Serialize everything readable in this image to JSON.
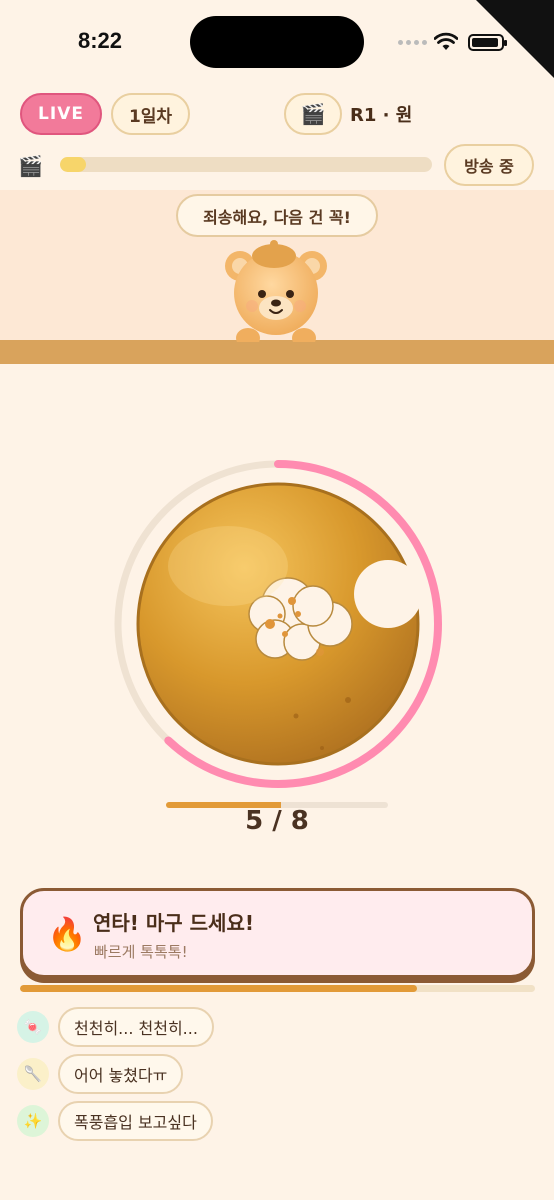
{
  "status_bar": {
    "time": "8:22"
  },
  "header": {
    "live_label": "LIVE",
    "day_label": "1일차",
    "round_icon": "clapperboard-icon",
    "round_label": "R1 · 원",
    "broadcast_progress": 0.07,
    "onair_label": "방송 중"
  },
  "stage": {
    "speech": "죄송해요, 다음 건 꼭!"
  },
  "bowl": {
    "ring_progress": 0.62,
    "meter_progress": 0.52,
    "count_label": "5 / 8"
  },
  "hint": {
    "icon": "fire-icon",
    "title": "연타! 마구 드세요!",
    "subtitle": "빠르게 톡톡톡!",
    "timer_progress": 0.77
  },
  "chat": [
    {
      "avatar_icon": "candy-icon",
      "avatar_color": "#D6F3E6",
      "avatar_glyph": "🍬",
      "text": "천천히... 천천히..."
    },
    {
      "avatar_icon": "spoon-icon",
      "avatar_color": "#FBF0C9",
      "avatar_glyph": "🥄",
      "text": "어어 놓쳤다ㅠ"
    },
    {
      "avatar_icon": "sparkle-icon",
      "avatar_color": "#DDF5D8",
      "avatar_glyph": "✨",
      "text": "폭풍흡입 보고싶다"
    }
  ],
  "colors": {
    "background": "#FEF3E7",
    "live": "#F27A9A",
    "ring": "#FF8BB0",
    "accent": "#E29A38",
    "card_border": "#8B5A34"
  }
}
